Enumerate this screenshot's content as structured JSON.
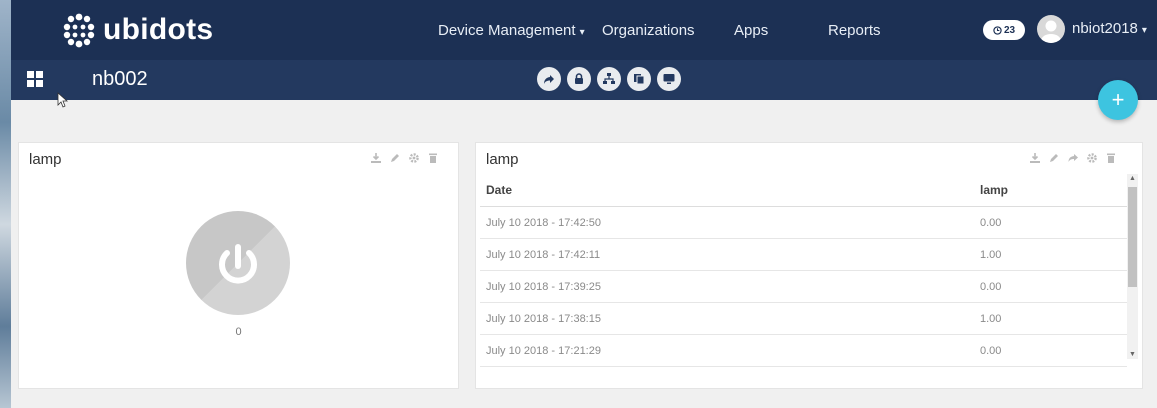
{
  "brand": {
    "name": "ubidots"
  },
  "nav": {
    "device_management": "Device Management",
    "organizations": "Organizations",
    "apps": "Apps",
    "reports": "Reports"
  },
  "badge": {
    "count": "23"
  },
  "user": {
    "name": "nbiot2018"
  },
  "dashboard": {
    "title": "nb002"
  },
  "toolbar_icons": [
    "share-icon",
    "lock-icon",
    "sitemap-icon",
    "copy-icon",
    "monitor-icon"
  ],
  "fab": {
    "label": "+"
  },
  "widgets": {
    "switch": {
      "title": "lamp",
      "value": "0",
      "state": 0,
      "icons": [
        "download-icon",
        "edit-icon",
        "settings-icon",
        "delete-icon"
      ]
    },
    "table": {
      "title": "lamp",
      "icons": [
        "download-icon",
        "edit-icon",
        "share-icon",
        "settings-icon",
        "delete-icon"
      ],
      "columns": [
        "Date",
        "lamp"
      ],
      "rows": [
        [
          "July 10 2018 - 17:42:50",
          "0.00"
        ],
        [
          "July 10 2018 - 17:42:11",
          "1.00"
        ],
        [
          "July 10 2018 - 17:39:25",
          "0.00"
        ],
        [
          "July 10 2018 - 17:38:15",
          "1.00"
        ],
        [
          "July 10 2018 - 17:21:29",
          "0.00"
        ]
      ]
    }
  },
  "colors": {
    "topbar": "#1c3054",
    "subbar": "#23395f",
    "accent": "#3dc4e0",
    "switch_off": "#c7c7c7"
  }
}
